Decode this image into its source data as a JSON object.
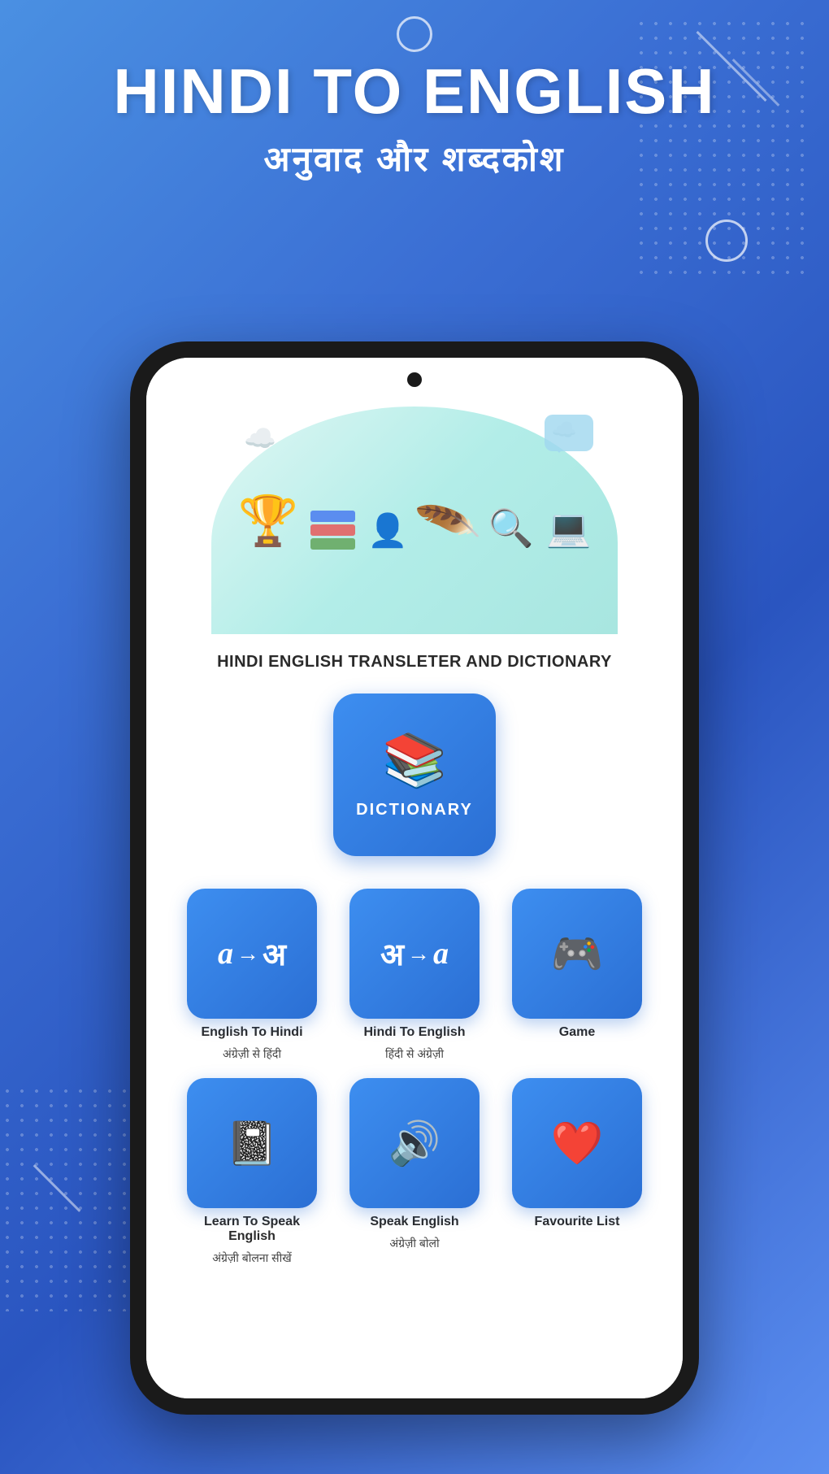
{
  "header": {
    "title_line1": "HINDI TO ENGLISH",
    "title_line2": "अनुवाद और शब्दकोश",
    "circle_top": "",
    "circle_right": ""
  },
  "phone": {
    "app_title": "HINDI ENGLISH TRANSLETER\nAND DICTIONARY",
    "dictionary_button": {
      "label": "DICTIONARY",
      "icon": "📖"
    },
    "features": [
      {
        "name": "English To Hindi",
        "name_hindi": "अंग्रेज़ी से हिंदी",
        "icon_type": "eng_to_hindi"
      },
      {
        "name": "Hindi To English",
        "name_hindi": "हिंदी से अंग्रेज़ी",
        "icon_type": "hindi_to_eng"
      },
      {
        "name": "Game",
        "name_hindi": "",
        "icon_type": "game"
      },
      {
        "name": "Learn To Speak English",
        "name_hindi": "अंग्रेज़ी बोलना सीखें",
        "icon_type": "book"
      },
      {
        "name": "Speak English",
        "name_hindi": "अंग्रेज़ी बोलो",
        "icon_type": "speaker"
      },
      {
        "name": "Favourite List",
        "name_hindi": "",
        "icon_type": "heart"
      }
    ]
  }
}
